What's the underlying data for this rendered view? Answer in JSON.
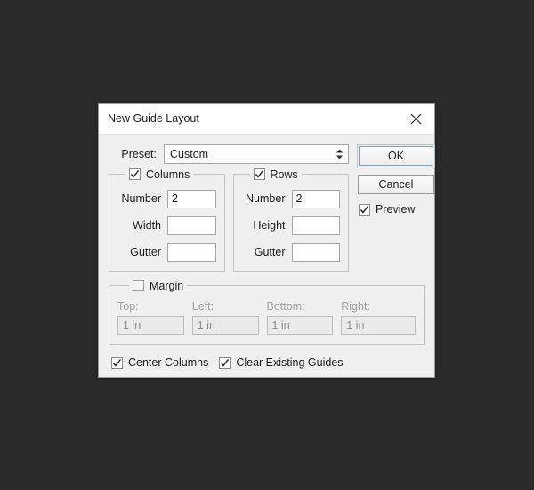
{
  "dialog": {
    "title": "New Guide Layout",
    "close_icon": "close-icon",
    "preset": {
      "label": "Preset:",
      "value": "Custom",
      "spinner_icon": "spinner-updown-icon"
    },
    "buttons": {
      "ok": "OK",
      "cancel": "Cancel"
    },
    "preview": {
      "label": "Preview",
      "checked": true
    },
    "columns": {
      "legend": "Columns",
      "checked": true,
      "fields": [
        {
          "label": "Number",
          "value": "2"
        },
        {
          "label": "Width",
          "value": ""
        },
        {
          "label": "Gutter",
          "value": ""
        }
      ]
    },
    "rows": {
      "legend": "Rows",
      "checked": true,
      "fields": [
        {
          "label": "Number",
          "value": "2"
        },
        {
          "label": "Height",
          "value": ""
        },
        {
          "label": "Gutter",
          "value": ""
        }
      ]
    },
    "margin": {
      "legend": "Margin",
      "checked": false,
      "enabled": false,
      "fields": [
        {
          "label": "Top:",
          "value": "1 in"
        },
        {
          "label": "Left:",
          "value": "1 in"
        },
        {
          "label": "Bottom:",
          "value": "1 in"
        },
        {
          "label": "Right:",
          "value": "1 in"
        }
      ]
    },
    "options": [
      {
        "label": "Center Columns",
        "checked": true
      },
      {
        "label": "Clear Existing Guides",
        "checked": true
      }
    ]
  },
  "colors": {
    "desktop": "#2a2a2a",
    "dialog_body": "#f0f0f0",
    "titlebar": "#ffffff",
    "focus_ring": "#a8c8e8",
    "disabled_text": "#9a9a9a"
  }
}
